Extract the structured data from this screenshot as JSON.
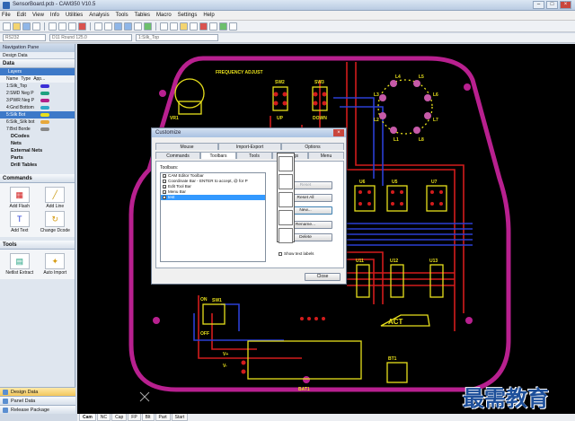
{
  "window": {
    "title": "SensorBoard.pcb - CAM350 V10.5"
  },
  "menu": [
    "File",
    "Edit",
    "View",
    "Info",
    "Utilities",
    "Analysis",
    "Tools",
    "Tables",
    "Macro",
    "Settings",
    "Help"
  ],
  "combos": {
    "units": "RS232",
    "dcode": "D11 Round 125.0",
    "layer": "1:Silk_Top"
  },
  "nav": {
    "title": "Navigation Pane",
    "subtitle": "Design Data",
    "data_section": "Data",
    "layers_label": "Layers",
    "layer_cols": [
      "Name",
      "Type",
      "App..."
    ],
    "layers": [
      {
        "name": "1:Silk_Top",
        "color": "#3b2fd6"
      },
      {
        "name": "2:SMD Neg P",
        "color": "#1fa17f"
      },
      {
        "name": "3:PWR Neg P",
        "color": "#b2208a"
      },
      {
        "name": "4:Gnd Bottom",
        "color": "#2ea7c7"
      },
      {
        "name": "5:Silk Bot",
        "color": "#e8e01c"
      },
      {
        "name": "6:Silk_Silk bot",
        "color": "#e7a83b"
      },
      {
        "name": "7:Brd Borde",
        "color": "#888888"
      }
    ],
    "data_groups": [
      "DCodes",
      "Nets",
      "External Nets",
      "Parts",
      "Drill Tables"
    ],
    "commands_section": "Commands",
    "commands": [
      "Add Flash",
      "Add Line",
      "Add Text",
      "Change Dcode"
    ],
    "tools_section": "Tools",
    "tools": [
      "Netlist Extract",
      "Auto Import",
      "Gerber Comp.",
      "Gen..."
    ],
    "footer": [
      "Design Data",
      "Panel Data",
      "Release Package"
    ]
  },
  "bottom_tabs": [
    "Cam",
    "NC",
    "Cap",
    "FP",
    "Blt",
    "Part",
    "Start"
  ],
  "dialog": {
    "title": "Customize",
    "tabs_row1": [
      "Mouse",
      "Import-Export",
      "Options"
    ],
    "tabs_row2": [
      "Commands",
      "Toolbars",
      "Tools",
      "Settings",
      "Menu"
    ],
    "active_tab": "Toolbars",
    "toolbars_label": "Toolbars:",
    "toolbars": [
      {
        "label": "CAM Editor Toolbar",
        "checked": true,
        "selected": false
      },
      {
        "label": "Coordinate Bar - ENTER to accept, @ for P",
        "checked": true,
        "selected": false
      },
      {
        "label": "Edit Tool Bar",
        "checked": true,
        "selected": false
      },
      {
        "label": "Menu Bar",
        "checked": true,
        "selected": false
      },
      {
        "label": "test",
        "checked": true,
        "selected": true
      }
    ],
    "buttons": [
      "Reset",
      "Reset All",
      "New...",
      "Rename...",
      "Delete"
    ],
    "show_text_labels": "Show text labels",
    "close_label": "Close"
  },
  "board_labels": {
    "freq": "FREQUENCY ADJUST",
    "vr1": "VR1",
    "sw2": "SW2",
    "sw3": "SW3",
    "up": "UP",
    "down": "DOWN",
    "leds": [
      "L4",
      "L5",
      "L3",
      "L6",
      "L2",
      "L7",
      "L1",
      "L8"
    ],
    "u6": "U6",
    "u5": "U5",
    "u7": "U7",
    "u11": "U11",
    "u12": "U12",
    "u13": "U13",
    "sw1": "SW1",
    "on": "ON",
    "off": "OFF",
    "bt1": "BT1",
    "bat1": "BAT1",
    "vp": "V+",
    "vm": "V-",
    "logo": "ACT"
  },
  "watermark": "最需教育",
  "colors": {
    "board_outline": "#b8208f",
    "trace_red": "#d21c1c",
    "trace_blue": "#2a3fd4",
    "silk_yellow": "#e8e01c"
  }
}
